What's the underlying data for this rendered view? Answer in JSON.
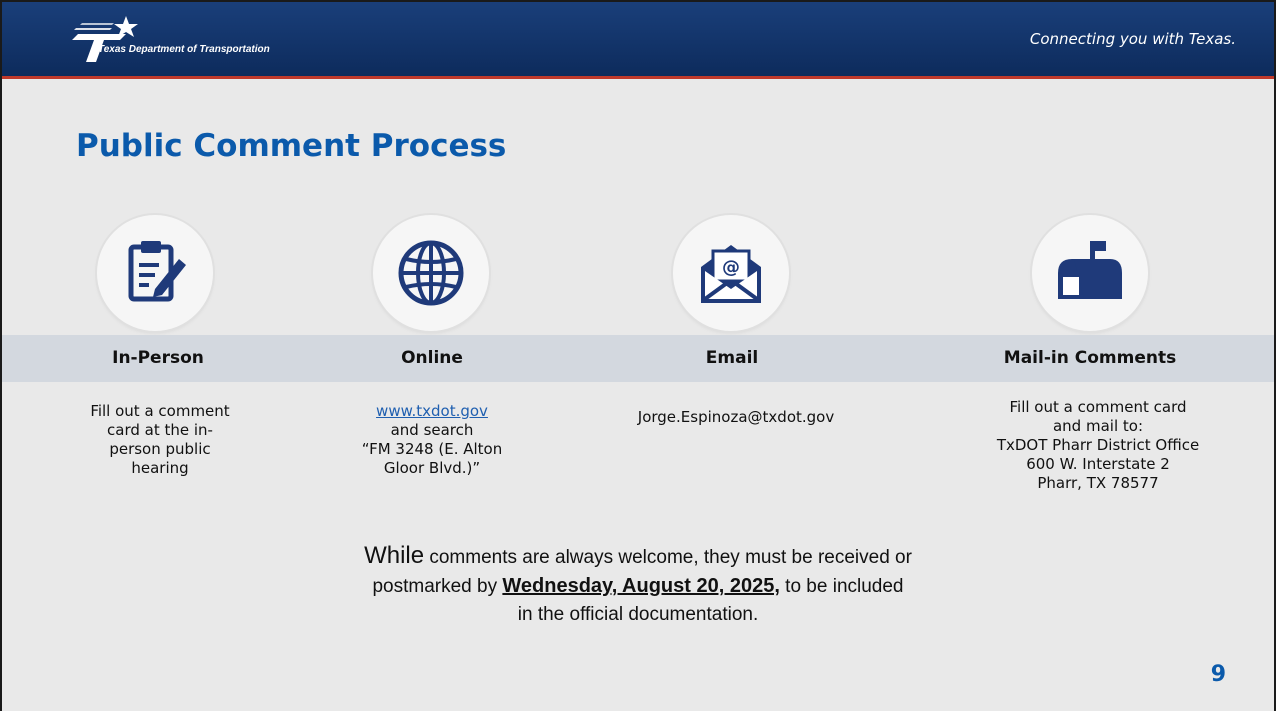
{
  "header": {
    "org_name": "Texas Department of Transportation",
    "tagline": "Connecting you with Texas."
  },
  "slide": {
    "title": "Public Comment Process",
    "page_number": "9"
  },
  "columns": [
    {
      "icon": "clipboard-edit-icon",
      "heading": "In-Person",
      "lines": [
        "Fill out a comment",
        "card at the in-",
        "person public",
        "hearing"
      ]
    },
    {
      "icon": "globe-icon",
      "heading": "Online",
      "link": "www.txdot.gov",
      "lines": [
        "and search",
        "“FM 3248 (E. Alton",
        "Gloor Blvd.)”"
      ]
    },
    {
      "icon": "envelope-at-icon",
      "heading": "Email",
      "lines": [
        "Jorge.Espinoza@txdot.gov"
      ]
    },
    {
      "icon": "mailbox-icon",
      "heading": "Mail-in Comments",
      "lines": [
        "Fill out a comment card",
        "and mail to:",
        "TxDOT Pharr District Office",
        "600 W. Interstate 2",
        "Pharr, TX 78577"
      ]
    }
  ],
  "notice": {
    "lead": "While",
    "part1": " comments are always welcome, they must be received or",
    "part2": "postmarked by ",
    "deadline": "Wednesday, August 20, 2025,",
    "part3": " to be included",
    "part4": "in the official documentation."
  },
  "colors": {
    "header_bg": "#0d2b5c",
    "accent_red": "#c0392b",
    "title_blue": "#0b5aab",
    "icon_blue": "#1f3a7a",
    "band_gray": "#d3d8df",
    "slide_bg": "#e9e9e9"
  }
}
